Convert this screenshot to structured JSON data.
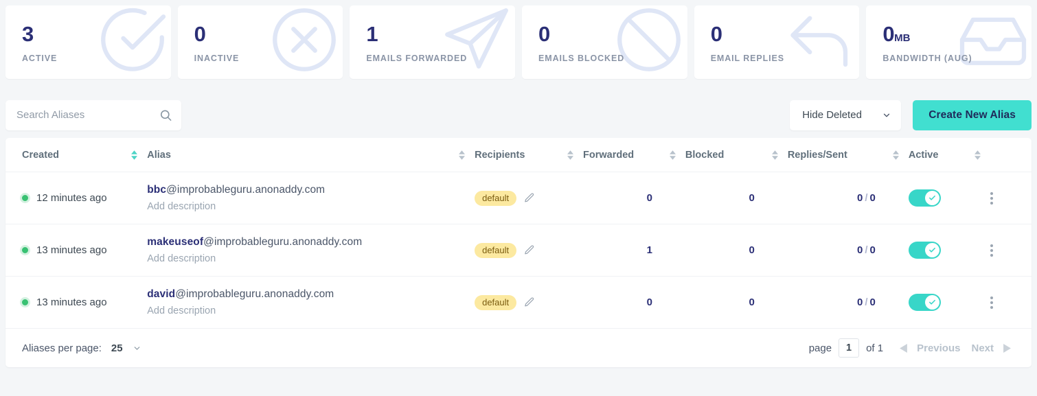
{
  "stats": [
    {
      "value": "3",
      "unit": "",
      "label": "ACTIVE",
      "icon": "check-circle-icon"
    },
    {
      "value": "0",
      "unit": "",
      "label": "INACTIVE",
      "icon": "x-circle-icon"
    },
    {
      "value": "1",
      "unit": "",
      "label": "EMAILS FORWARDED",
      "icon": "send-icon"
    },
    {
      "value": "0",
      "unit": "",
      "label": "EMAILS BLOCKED",
      "icon": "ban-icon"
    },
    {
      "value": "0",
      "unit": "",
      "label": "EMAIL REPLIES",
      "icon": "reply-arrow-icon"
    },
    {
      "value": "0",
      "unit": "MB",
      "label": "BANDWIDTH (AUG)",
      "icon": "inbox-icon"
    }
  ],
  "toolbar": {
    "search_placeholder": "Search Aliases",
    "search_value": "",
    "filter_selected": "Hide Deleted",
    "create_label": "Create New Alias"
  },
  "table": {
    "headers": [
      {
        "label": "Created",
        "sort_active": true
      },
      {
        "label": "Alias",
        "sort_active": false
      },
      {
        "label": "Recipients",
        "sort_active": false
      },
      {
        "label": "Forwarded",
        "sort_active": false
      },
      {
        "label": "Blocked",
        "sort_active": false
      },
      {
        "label": "Replies/Sent",
        "sort_active": false
      },
      {
        "label": "Active",
        "sort_active": false
      }
    ],
    "rows": [
      {
        "created": "12 minutes ago",
        "alias_local": "bbc",
        "alias_domain": "@improbableguru.anonaddy.com",
        "description": "Add description",
        "recipient": "default",
        "forwarded": "0",
        "blocked": "0",
        "replies": "0",
        "sent": "0",
        "active": true
      },
      {
        "created": "13 minutes ago",
        "alias_local": "makeuseof",
        "alias_domain": "@improbableguru.anonaddy.com",
        "description": "Add description",
        "recipient": "default",
        "forwarded": "1",
        "blocked": "0",
        "replies": "0",
        "sent": "0",
        "active": true
      },
      {
        "created": "13 minutes ago",
        "alias_local": "david",
        "alias_domain": "@improbableguru.anonaddy.com",
        "description": "Add description",
        "recipient": "default",
        "forwarded": "0",
        "blocked": "0",
        "replies": "0",
        "sent": "0",
        "active": true
      }
    ]
  },
  "footer": {
    "per_page_label": "Aliases per page:",
    "per_page_value": "25",
    "page_label": "page",
    "page_value": "1",
    "page_total": "of 1",
    "previous_label": "Previous",
    "next_label": "Next"
  },
  "colors": {
    "accent_teal": "#41dfd0",
    "navy": "#2b2f76",
    "badge_yellow": "#fce9a0",
    "status_green": "#38c172",
    "page_bg": "#f4f6f8"
  }
}
